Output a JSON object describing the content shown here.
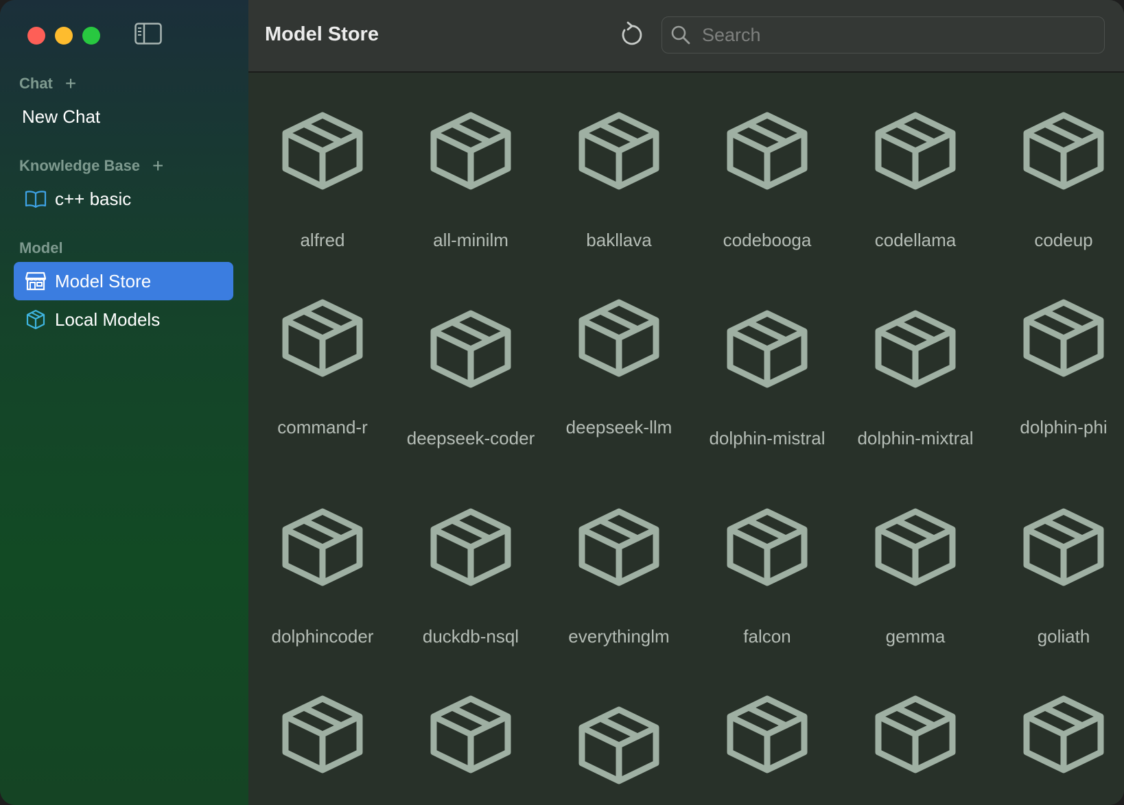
{
  "sidebar": {
    "chat_header": "Chat",
    "new_chat": "New Chat",
    "kb_header": "Knowledge Base",
    "kb_items": [
      "c++ basic"
    ],
    "model_header": "Model",
    "model_items": [
      "Model Store",
      "Local Models"
    ],
    "selected": "Model Store"
  },
  "toolbar": {
    "title": "Model Store",
    "search_placeholder": "Search"
  },
  "models": [
    "alfred",
    "all-minilm",
    "bakllava",
    "codebooga",
    "codellama",
    "codeup",
    "command-r",
    "deepseek-coder",
    "deepseek-llm",
    "dolphin-mistral",
    "dolphin-mixtral",
    "dolphin-phi",
    "dolphincoder",
    "duckdb-nsql",
    "everythinglm",
    "falcon",
    "gemma",
    "goliath"
  ],
  "colors": {
    "selection": "#3b7de0",
    "icon": "#9fb0a3",
    "label": "#b5bdb6"
  },
  "icons": {
    "model_tile": "package-icon",
    "store": "store-icon",
    "local": "cube-icon",
    "kb": "book-icon"
  }
}
